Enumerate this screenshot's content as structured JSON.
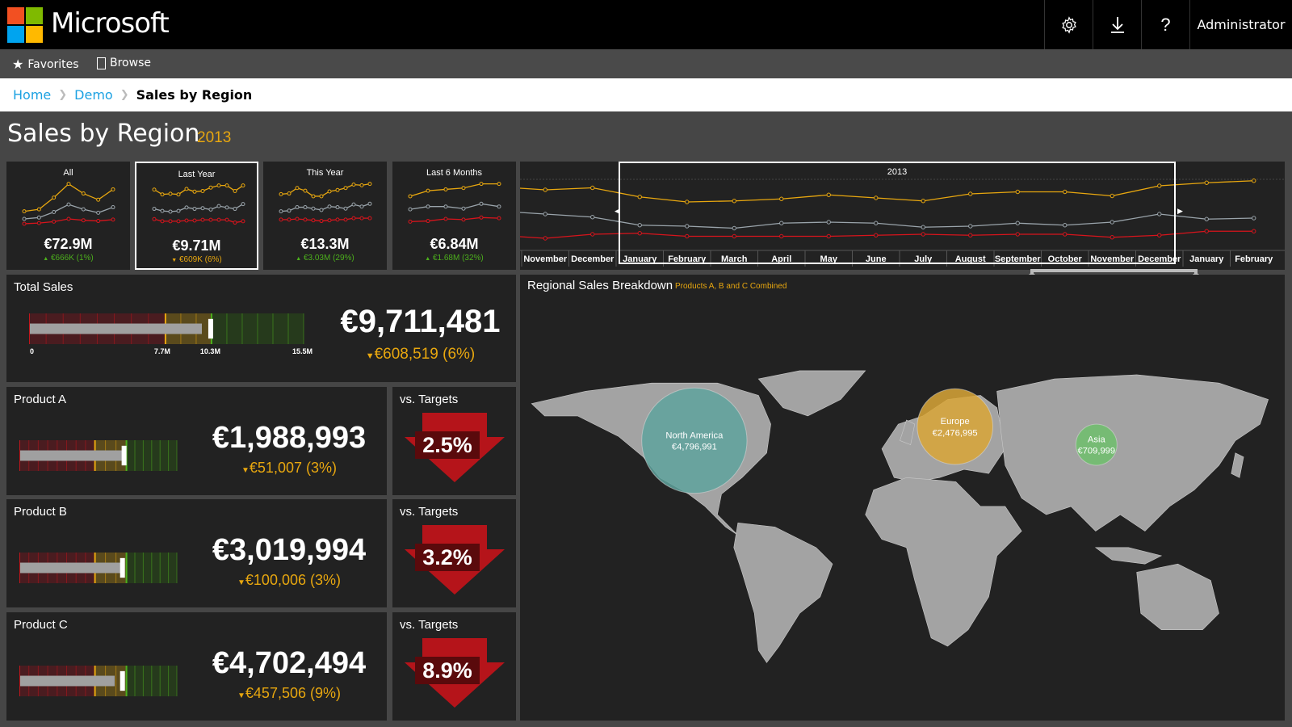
{
  "header": {
    "brand": "Microsoft",
    "logo_colors": [
      "#f25022",
      "#7fba00",
      "#00a4ef",
      "#ffb900"
    ],
    "icons": [
      "gear-icon",
      "download-icon",
      "help-icon"
    ],
    "help_glyph": "?",
    "user": "Administrator"
  },
  "nav": {
    "items": [
      {
        "label": "Favorites",
        "icon": "star-icon"
      },
      {
        "label": "Browse",
        "icon": "document-icon"
      }
    ]
  },
  "breadcrumb": {
    "items": [
      "Home",
      "Demo"
    ],
    "current": "Sales by Region"
  },
  "page": {
    "title": "Sales by Region",
    "year": "2013"
  },
  "colors": {
    "orange": "#e8a70f",
    "gray": "#9aa4ab",
    "red": "#d8141c",
    "green": "#4caf1c",
    "na": "#5fa39e",
    "europe": "#d9a637",
    "asia": "#6fbf6c"
  },
  "tiles": [
    {
      "label": "All",
      "value": "€72.9M",
      "delta": "€666K (1%)",
      "dir": "up",
      "selected": false,
      "series": [
        [
          31,
          34,
          51,
          71,
          57,
          48,
          63
        ],
        [
          20,
          22,
          30,
          41,
          34,
          29,
          37
        ],
        [
          13,
          14,
          16,
          20,
          18,
          17,
          19
        ]
      ]
    },
    {
      "label": "Last Year",
      "value": "€9.71M",
      "delta": "€609K (6%)",
      "dir": "down",
      "selected": true,
      "series": [
        [
          65,
          58,
          59,
          58,
          66,
          62,
          63,
          68,
          71,
          71,
          63,
          71
        ],
        [
          37,
          34,
          33,
          34,
          39,
          37,
          38,
          36,
          41,
          39,
          37,
          44
        ],
        [
          22,
          19,
          19,
          19,
          20,
          20,
          21,
          21,
          21,
          21,
          17,
          19
        ]
      ]
    },
    {
      "label": "This Year",
      "value": "€13.3M",
      "delta": "€3.03M (29%)",
      "dir": "up",
      "selected": false,
      "series": [
        [
          56,
          57,
          65,
          61,
          53,
          53,
          60,
          62,
          65,
          70,
          69,
          71
        ],
        [
          31,
          32,
          37,
          37,
          35,
          33,
          38,
          37,
          35,
          41,
          38,
          42
        ],
        [
          19,
          19,
          20,
          19,
          18,
          17,
          18,
          19,
          19,
          21,
          21,
          21
        ]
      ]
    },
    {
      "label": "Last 6 Months",
      "value": "€6.84M",
      "delta": "€1.68M (32%)",
      "dir": "up",
      "selected": false,
      "series": [
        [
          53,
          61,
          63,
          65,
          71,
          71
        ],
        [
          34,
          38,
          38,
          35,
          42,
          38
        ],
        [
          16,
          17,
          20,
          19,
          22,
          21
        ]
      ]
    }
  ],
  "timeline": {
    "year_label": "2013",
    "months": [
      "November",
      "December",
      "January",
      "February",
      "March",
      "April",
      "May",
      "June",
      "July",
      "August",
      "September",
      "October",
      "November",
      "December",
      "January",
      "February"
    ],
    "selected_range": [
      "January",
      "December"
    ],
    "series": [
      [
        52,
        54,
        45,
        40,
        41,
        43,
        47,
        44,
        41,
        48,
        50,
        50,
        46,
        56,
        59,
        61
      ],
      [
        28,
        25,
        17,
        16,
        14,
        19,
        20,
        19,
        15,
        16,
        19,
        17,
        20,
        28,
        23,
        24
      ],
      [
        4,
        8,
        9,
        6,
        6,
        6,
        6,
        7,
        8,
        7,
        8,
        8,
        5,
        7,
        11,
        11
      ]
    ]
  },
  "total": {
    "label": "Total Sales",
    "value": "€9,711,481",
    "delta": "€608,519 (6%)",
    "dir": "down",
    "scale_max": 15.5,
    "ticks": [
      "0",
      "7.7M",
      "10.3M",
      "15.5M"
    ],
    "bands": [
      7.7,
      10.3,
      15.5
    ],
    "actual": 9.71,
    "target": 10.3
  },
  "products": [
    {
      "label": "Product A",
      "value": "€1,988,993",
      "delta": "€51,007 (3%)",
      "dir": "down",
      "actual_fraction": 0.66,
      "target_fraction": 0.67,
      "vs_label": "vs. Targets",
      "vs_value": "2.5%"
    },
    {
      "label": "Product B",
      "value": "€3,019,994",
      "delta": "€100,006 (3%)",
      "dir": "down",
      "actual_fraction": 0.64,
      "target_fraction": 0.66,
      "vs_label": "vs. Targets",
      "vs_value": "3.2%"
    },
    {
      "label": "Product C",
      "value": "€4,702,494",
      "delta": "€457,506 (9%)",
      "dir": "down",
      "actual_fraction": 0.6,
      "target_fraction": 0.66,
      "vs_label": "vs. Targets",
      "vs_value": "8.9%"
    }
  ],
  "map": {
    "title": "Regional Sales Breakdown",
    "subtitle": "Products A, B and C Combined",
    "regions": [
      {
        "name": "North America",
        "value": "€4,796,991"
      },
      {
        "name": "Europe",
        "value": "€2,476,995"
      },
      {
        "name": "Asia",
        "value": "€709,999"
      }
    ]
  }
}
